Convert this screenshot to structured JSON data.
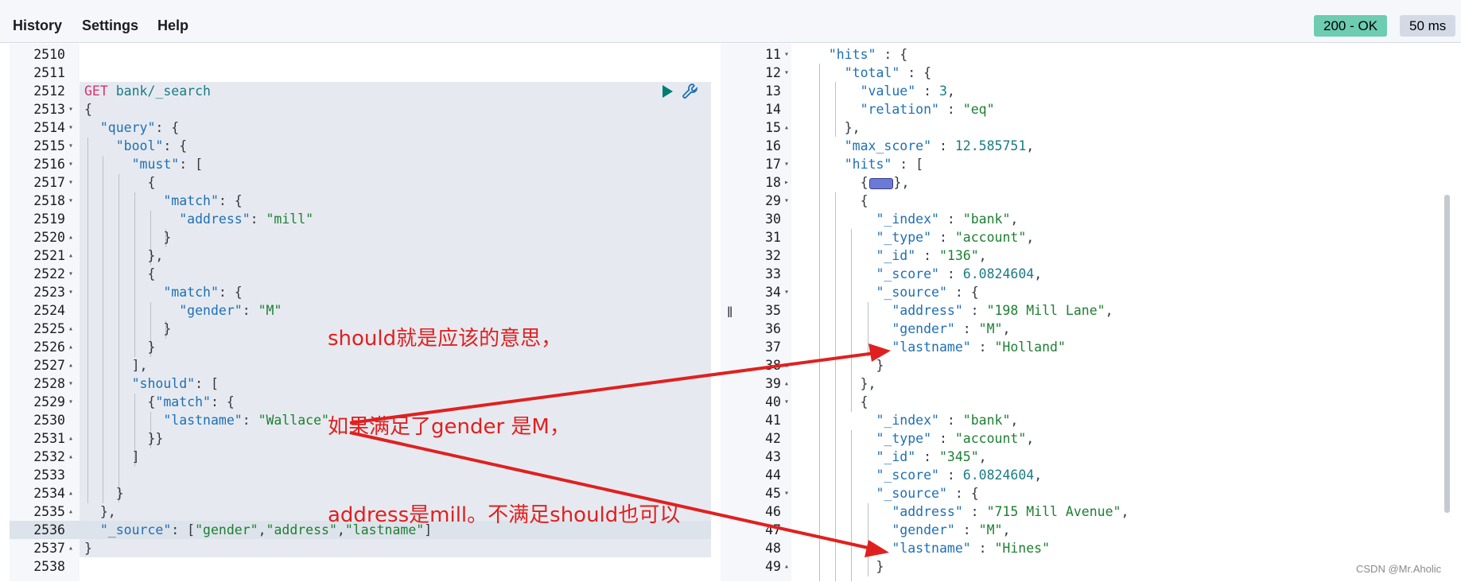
{
  "menu": {
    "history": "History",
    "settings": "Settings",
    "help": "Help"
  },
  "status": {
    "code": "200 - OK",
    "time": "50 ms"
  },
  "colors": {
    "accent": "#017d73",
    "annotation": "#e02020"
  },
  "request": {
    "lines": [
      {
        "n": "2510",
        "fold": "",
        "t": [
          {
            "x": ""
          }
        ]
      },
      {
        "n": "2511",
        "fold": "",
        "t": [
          {
            "x": ""
          }
        ]
      },
      {
        "n": "2512",
        "fold": "",
        "t": [
          {
            "x": "GET",
            "c": "m"
          },
          {
            "x": " "
          },
          {
            "x": "bank/_search",
            "c": "u"
          }
        ]
      },
      {
        "n": "2513",
        "fold": "▾",
        "t": [
          {
            "x": "{"
          }
        ]
      },
      {
        "n": "2514",
        "fold": "▾",
        "t": [
          {
            "x": "  "
          },
          {
            "x": "\"query\"",
            "c": "k"
          },
          {
            "x": ": {"
          }
        ]
      },
      {
        "n": "2515",
        "fold": "▾",
        "t": [
          {
            "x": "    "
          },
          {
            "x": "\"bool\"",
            "c": "k"
          },
          {
            "x": ": {"
          }
        ]
      },
      {
        "n": "2516",
        "fold": "▾",
        "t": [
          {
            "x": "      "
          },
          {
            "x": "\"must\"",
            "c": "k"
          },
          {
            "x": ": ["
          }
        ]
      },
      {
        "n": "2517",
        "fold": "▾",
        "t": [
          {
            "x": "        {"
          }
        ]
      },
      {
        "n": "2518",
        "fold": "▾",
        "t": [
          {
            "x": "          "
          },
          {
            "x": "\"match\"",
            "c": "k"
          },
          {
            "x": ": {"
          }
        ]
      },
      {
        "n": "2519",
        "fold": "",
        "t": [
          {
            "x": "            "
          },
          {
            "x": "\"address\"",
            "c": "k"
          },
          {
            "x": ": "
          },
          {
            "x": "\"mill\"",
            "c": "s"
          }
        ]
      },
      {
        "n": "2520",
        "fold": "▴",
        "t": [
          {
            "x": "          }"
          }
        ]
      },
      {
        "n": "2521",
        "fold": "▴",
        "t": [
          {
            "x": "        },"
          }
        ]
      },
      {
        "n": "2522",
        "fold": "▾",
        "t": [
          {
            "x": "        {"
          }
        ]
      },
      {
        "n": "2523",
        "fold": "▾",
        "t": [
          {
            "x": "          "
          },
          {
            "x": "\"match\"",
            "c": "k"
          },
          {
            "x": ": {"
          }
        ]
      },
      {
        "n": "2524",
        "fold": "",
        "t": [
          {
            "x": "            "
          },
          {
            "x": "\"gender\"",
            "c": "k"
          },
          {
            "x": ": "
          },
          {
            "x": "\"M\"",
            "c": "s"
          }
        ]
      },
      {
        "n": "2525",
        "fold": "▴",
        "t": [
          {
            "x": "          }"
          }
        ]
      },
      {
        "n": "2526",
        "fold": "▴",
        "t": [
          {
            "x": "        }"
          }
        ]
      },
      {
        "n": "2527",
        "fold": "▴",
        "t": [
          {
            "x": "      ],"
          }
        ]
      },
      {
        "n": "2528",
        "fold": "▾",
        "t": [
          {
            "x": "      "
          },
          {
            "x": "\"should\"",
            "c": "k"
          },
          {
            "x": ": ["
          }
        ]
      },
      {
        "n": "2529",
        "fold": "▾",
        "t": [
          {
            "x": "        {"
          },
          {
            "x": "\"match\"",
            "c": "k"
          },
          {
            "x": ": {"
          }
        ]
      },
      {
        "n": "2530",
        "fold": "",
        "t": [
          {
            "x": "          "
          },
          {
            "x": "\"lastname\"",
            "c": "k"
          },
          {
            "x": ": "
          },
          {
            "x": "\"Wallace\"",
            "c": "s"
          }
        ]
      },
      {
        "n": "2531",
        "fold": "▴",
        "t": [
          {
            "x": "        }}"
          }
        ]
      },
      {
        "n": "2532",
        "fold": "▴",
        "t": [
          {
            "x": "      ]"
          }
        ]
      },
      {
        "n": "2533",
        "fold": "",
        "t": [
          {
            "x": ""
          }
        ]
      },
      {
        "n": "2534",
        "fold": "▴",
        "t": [
          {
            "x": "    }"
          }
        ]
      },
      {
        "n": "2535",
        "fold": "▴",
        "t": [
          {
            "x": "  },"
          }
        ]
      },
      {
        "n": "2536",
        "fold": "",
        "t": [
          {
            "x": "  "
          },
          {
            "x": "\"_source\"",
            "c": "k"
          },
          {
            "x": ": ["
          },
          {
            "x": "\"gender\"",
            "c": "s"
          },
          {
            "x": ","
          },
          {
            "x": "\"address\"",
            "c": "s"
          },
          {
            "x": ","
          },
          {
            "x": "\"lastname\"",
            "c": "s"
          },
          {
            "x": "]"
          }
        ]
      },
      {
        "n": "2537",
        "fold": "▴",
        "t": [
          {
            "x": "}"
          }
        ]
      },
      {
        "n": "2538",
        "fold": "",
        "t": [
          {
            "x": ""
          }
        ]
      }
    ]
  },
  "response": {
    "lines": [
      {
        "n": "11",
        "fold": "▾",
        "t": [
          {
            "x": "  "
          },
          {
            "x": "\"hits\"",
            "c": "k"
          },
          {
            "x": " : {"
          }
        ]
      },
      {
        "n": "12",
        "fold": "▾",
        "t": [
          {
            "x": "    "
          },
          {
            "x": "\"total\"",
            "c": "k"
          },
          {
            "x": " : {"
          }
        ]
      },
      {
        "n": "13",
        "fold": "",
        "t": [
          {
            "x": "      "
          },
          {
            "x": "\"value\"",
            "c": "k"
          },
          {
            "x": " : "
          },
          {
            "x": "3",
            "c": "n"
          },
          {
            "x": ","
          }
        ]
      },
      {
        "n": "14",
        "fold": "",
        "t": [
          {
            "x": "      "
          },
          {
            "x": "\"relation\"",
            "c": "k"
          },
          {
            "x": " : "
          },
          {
            "x": "\"eq\"",
            "c": "s"
          }
        ]
      },
      {
        "n": "15",
        "fold": "▴",
        "t": [
          {
            "x": "    },"
          }
        ]
      },
      {
        "n": "16",
        "fold": "",
        "t": [
          {
            "x": "    "
          },
          {
            "x": "\"max_score\"",
            "c": "k"
          },
          {
            "x": " : "
          },
          {
            "x": "12.585751",
            "c": "n"
          },
          {
            "x": ","
          }
        ]
      },
      {
        "n": "17",
        "fold": "▾",
        "t": [
          {
            "x": "    "
          },
          {
            "x": "\"hits\"",
            "c": "k"
          },
          {
            "x": " : ["
          }
        ]
      },
      {
        "n": "18",
        "fold": "▸",
        "t": [
          {
            "x": "      {"
          },
          {
            "x": "",
            "c": "collapsed"
          },
          {
            "x": "},"
          }
        ]
      },
      {
        "n": "29",
        "fold": "▾",
        "t": [
          {
            "x": "      {"
          }
        ]
      },
      {
        "n": "30",
        "fold": "",
        "t": [
          {
            "x": "        "
          },
          {
            "x": "\"_index\"",
            "c": "k"
          },
          {
            "x": " : "
          },
          {
            "x": "\"bank\"",
            "c": "s"
          },
          {
            "x": ","
          }
        ]
      },
      {
        "n": "31",
        "fold": "",
        "t": [
          {
            "x": "        "
          },
          {
            "x": "\"_type\"",
            "c": "k"
          },
          {
            "x": " : "
          },
          {
            "x": "\"account\"",
            "c": "s"
          },
          {
            "x": ","
          }
        ]
      },
      {
        "n": "32",
        "fold": "",
        "t": [
          {
            "x": "        "
          },
          {
            "x": "\"_id\"",
            "c": "k"
          },
          {
            "x": " : "
          },
          {
            "x": "\"136\"",
            "c": "s"
          },
          {
            "x": ","
          }
        ]
      },
      {
        "n": "33",
        "fold": "",
        "t": [
          {
            "x": "        "
          },
          {
            "x": "\"_score\"",
            "c": "k"
          },
          {
            "x": " : "
          },
          {
            "x": "6.0824604",
            "c": "n"
          },
          {
            "x": ","
          }
        ]
      },
      {
        "n": "34",
        "fold": "▾",
        "t": [
          {
            "x": "        "
          },
          {
            "x": "\"_source\"",
            "c": "k"
          },
          {
            "x": " : {"
          }
        ]
      },
      {
        "n": "35",
        "fold": "",
        "t": [
          {
            "x": "          "
          },
          {
            "x": "\"address\"",
            "c": "k"
          },
          {
            "x": " : "
          },
          {
            "x": "\"198 Mill Lane\"",
            "c": "s"
          },
          {
            "x": ","
          }
        ]
      },
      {
        "n": "36",
        "fold": "",
        "t": [
          {
            "x": "          "
          },
          {
            "x": "\"gender\"",
            "c": "k"
          },
          {
            "x": " : "
          },
          {
            "x": "\"M\"",
            "c": "s"
          },
          {
            "x": ","
          }
        ]
      },
      {
        "n": "37",
        "fold": "",
        "t": [
          {
            "x": "          "
          },
          {
            "x": "\"lastname\"",
            "c": "k"
          },
          {
            "x": " : "
          },
          {
            "x": "\"Holland\"",
            "c": "s"
          }
        ]
      },
      {
        "n": "38",
        "fold": "▴",
        "t": [
          {
            "x": "        }"
          }
        ]
      },
      {
        "n": "39",
        "fold": "▴",
        "t": [
          {
            "x": "      },"
          }
        ]
      },
      {
        "n": "40",
        "fold": "▾",
        "t": [
          {
            "x": "      {"
          }
        ]
      },
      {
        "n": "41",
        "fold": "",
        "t": [
          {
            "x": "        "
          },
          {
            "x": "\"_index\"",
            "c": "k"
          },
          {
            "x": " : "
          },
          {
            "x": "\"bank\"",
            "c": "s"
          },
          {
            "x": ","
          }
        ]
      },
      {
        "n": "42",
        "fold": "",
        "t": [
          {
            "x": "        "
          },
          {
            "x": "\"_type\"",
            "c": "k"
          },
          {
            "x": " : "
          },
          {
            "x": "\"account\"",
            "c": "s"
          },
          {
            "x": ","
          }
        ]
      },
      {
        "n": "43",
        "fold": "",
        "t": [
          {
            "x": "        "
          },
          {
            "x": "\"_id\"",
            "c": "k"
          },
          {
            "x": " : "
          },
          {
            "x": "\"345\"",
            "c": "s"
          },
          {
            "x": ","
          }
        ]
      },
      {
        "n": "44",
        "fold": "",
        "t": [
          {
            "x": "        "
          },
          {
            "x": "\"_score\"",
            "c": "k"
          },
          {
            "x": " : "
          },
          {
            "x": "6.0824604",
            "c": "n"
          },
          {
            "x": ","
          }
        ]
      },
      {
        "n": "45",
        "fold": "▾",
        "t": [
          {
            "x": "        "
          },
          {
            "x": "\"_source\"",
            "c": "k"
          },
          {
            "x": " : {"
          }
        ]
      },
      {
        "n": "46",
        "fold": "",
        "t": [
          {
            "x": "          "
          },
          {
            "x": "\"address\"",
            "c": "k"
          },
          {
            "x": " : "
          },
          {
            "x": "\"715 Mill Avenue\"",
            "c": "s"
          },
          {
            "x": ","
          }
        ]
      },
      {
        "n": "47",
        "fold": "",
        "t": [
          {
            "x": "          "
          },
          {
            "x": "\"gender\"",
            "c": "k"
          },
          {
            "x": " : "
          },
          {
            "x": "\"M\"",
            "c": "s"
          },
          {
            "x": ","
          }
        ]
      },
      {
        "n": "48",
        "fold": "",
        "t": [
          {
            "x": "          "
          },
          {
            "x": "\"lastname\"",
            "c": "k"
          },
          {
            "x": " : "
          },
          {
            "x": "\"Hines\"",
            "c": "s"
          }
        ]
      },
      {
        "n": "49",
        "fold": "▴",
        "t": [
          {
            "x": "        }"
          }
        ]
      }
    ]
  },
  "annotation": {
    "lines": [
      "should就是应该的意思，",
      "如果满足了gender 是M，",
      "address是mill。不满足should也可以"
    ]
  },
  "watermark": "CSDN @Mr.Aholic"
}
